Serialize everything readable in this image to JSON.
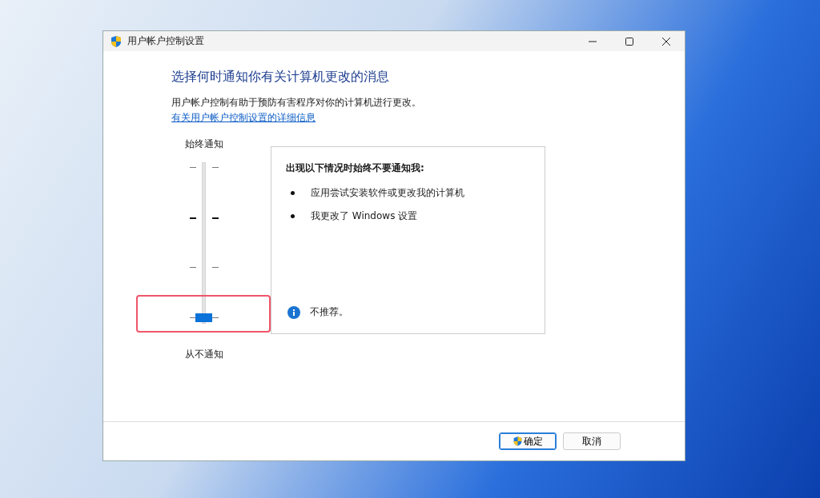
{
  "window": {
    "title": "用户帐户控制设置"
  },
  "heading": "选择何时通知你有关计算机更改的消息",
  "description": "用户帐户控制有助于预防有害程序对你的计算机进行更改。",
  "link": "有关用户帐户控制设置的详细信息",
  "slider": {
    "top_label": "始终通知",
    "bottom_label": "从不通知",
    "level": 0
  },
  "panel": {
    "title": "出现以下情况时始终不要通知我:",
    "items": [
      "应用尝试安装软件或更改我的计算机",
      "我更改了 Windows 设置"
    ],
    "note": "不推荐。"
  },
  "buttons": [
    {
      "label": "确定",
      "kind": "shield",
      "default": true
    },
    {
      "label": "取消",
      "kind": "plain",
      "default": false
    }
  ]
}
